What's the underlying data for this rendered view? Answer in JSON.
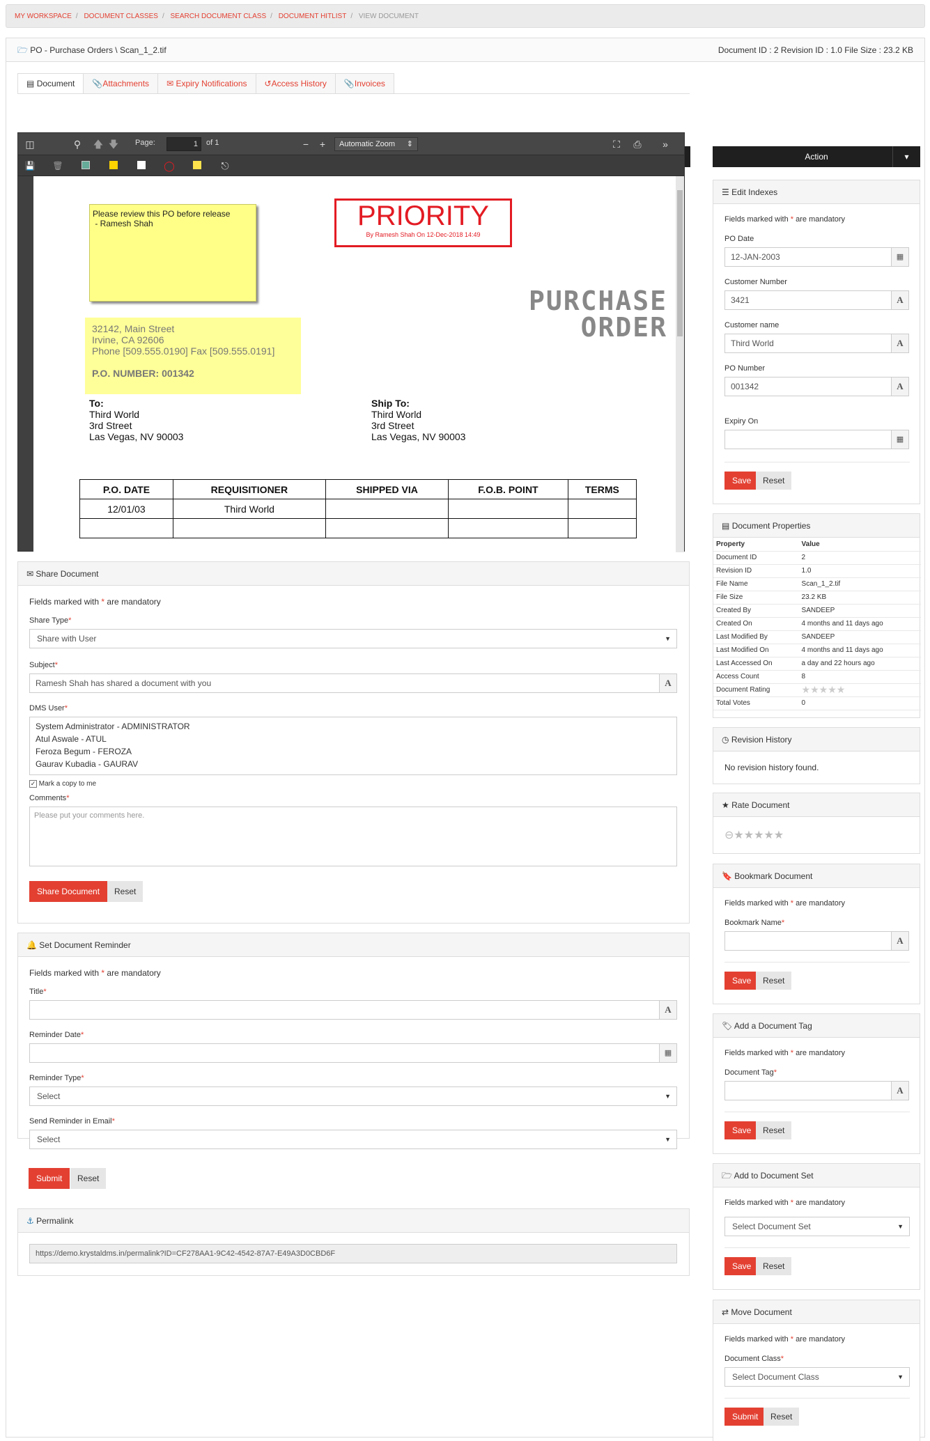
{
  "breadcrumb": [
    "MY WORKSPACE",
    "DOCUMENT CLASSES",
    "SEARCH DOCUMENT CLASS",
    "DOCUMENT HITLIST",
    "VIEW DOCUMENT"
  ],
  "doc_header": {
    "path": "PO - Purchase Orders \\ Scan_1_2.tif",
    "meta": "Document ID : 2  Revision ID : 1.0  File Size : 23.2 KB"
  },
  "tabs": [
    "Document",
    "Attachments",
    "Expiry Notifications",
    "Access History",
    "Invoices"
  ],
  "viewer": {
    "page_label": "Page:",
    "page_value": "1",
    "page_of": "of 1",
    "zoom": "Automatic Zoom"
  },
  "scan": {
    "sticky_note": "Please review this PO before release\n - Ramesh Shah",
    "stamp_title": "PRIORITY",
    "stamp_sub": "By Ramesh Shah On 12-Dec-2018 14:49",
    "address_line1": "32142, Main Street",
    "address_line2": "Irvine, CA 92606",
    "address_phone": "Phone [509.555.0190]  Fax [509.555.0191]",
    "po_number": "P.O. NUMBER: 001342",
    "title_line1": "PURCHASE",
    "title_line2": "ORDER",
    "to_label": "To:",
    "to_lines": [
      "Third World",
      "3rd Street",
      "Las Vegas, NV 90003"
    ],
    "ship_label": "Ship To:",
    "ship_lines": [
      "Third World",
      "3rd Street",
      "Las Vegas, NV 90003"
    ],
    "table_headers": [
      "P.O. DATE",
      "REQUISITIONER",
      "SHIPPED VIA",
      "F.O.B. POINT",
      "TERMS"
    ],
    "table_row": [
      "12/01/03",
      "Third World",
      "",
      "",
      ""
    ]
  },
  "share": {
    "title": "Share Document",
    "mandatory": "Fields marked with",
    "mandatory_tail": "are mandatory",
    "share_type_label": "Share Type",
    "share_type_value": "Share with User",
    "subject_label": "Subject",
    "subject_value": "Ramesh Shah has shared a document with you",
    "dms_user_label": "DMS User",
    "users": [
      "System Administrator - ADMINISTRATOR",
      "Atul Aswale - ATUL",
      "Feroza Begum - FEROZA",
      "Gaurav Kubadia - GAURAV"
    ],
    "copy_label": "Mark a copy to me",
    "comments_label": "Comments",
    "comments_placeholder": "Please put your comments here.",
    "submit": "Share Document",
    "reset": "Reset"
  },
  "reminder": {
    "title": "Set Document Reminder",
    "mandatory": "Fields marked with",
    "mandatory_tail": "are mandatory",
    "title_label": "Title",
    "date_label": "Reminder Date",
    "type_label": "Reminder Type",
    "type_value": "Select",
    "email_label": "Send Reminder in Email",
    "email_value": "Select",
    "submit": "Submit",
    "reset": "Reset"
  },
  "permalink": {
    "title": "Permalink",
    "url": "https://demo.krystaldms.in/permalink?ID=CF278AA1-9C42-4542-87A7-E49A3D0CBD6F"
  },
  "action": {
    "label": "Action"
  },
  "edit_indexes": {
    "title": "Edit Indexes",
    "mandatory": "Fields marked with",
    "mandatory_tail": "are mandatory",
    "fields": [
      {
        "label": "PO Date",
        "value": "12-JAN-2003"
      },
      {
        "label": "Customer Number",
        "value": "3421"
      },
      {
        "label": "Customer name",
        "value": "Third World"
      },
      {
        "label": "PO Number",
        "value": "001342"
      },
      {
        "label": "Expiry On",
        "value": ""
      }
    ],
    "save": "Save",
    "reset": "Reset"
  },
  "properties": {
    "title": "Document Properties",
    "head_property": "Property",
    "head_value": "Value",
    "rows": [
      [
        "Document ID",
        "2"
      ],
      [
        "Revision ID",
        "1.0"
      ],
      [
        "File Name",
        "Scan_1_2.tif"
      ],
      [
        "File Size",
        "23.2 KB"
      ],
      [
        "Created By",
        "SANDEEP"
      ],
      [
        "Created On",
        "4 months and 11 days ago"
      ],
      [
        "Last Modified By",
        "SANDEEP"
      ],
      [
        "Last Modified On",
        "4 months and 11 days ago"
      ],
      [
        "Last Accessed On",
        "a day and 22 hours ago"
      ],
      [
        "Access Count",
        "8"
      ],
      [
        "Document Rating",
        ""
      ],
      [
        "Total Votes",
        "0"
      ]
    ]
  },
  "revision": {
    "title": "Revision History",
    "text": "No revision history found."
  },
  "rate": {
    "title": "Rate Document"
  },
  "bookmark": {
    "title": "Bookmark Document",
    "mandatory": "Fields marked with",
    "mandatory_tail": "are mandatory",
    "label": "Bookmark Name",
    "save": "Save",
    "reset": "Reset"
  },
  "tag": {
    "title": "Add a Document Tag",
    "mandatory": "Fields marked with",
    "mandatory_tail": "are mandatory",
    "label": "Document Tag",
    "save": "Save",
    "reset": "Reset"
  },
  "docset": {
    "title": "Add to Document Set",
    "mandatory": "Fields marked with",
    "mandatory_tail": "are mandatory",
    "select": "Select Document Set",
    "save": "Save",
    "reset": "Reset"
  },
  "move": {
    "title": "Move Document",
    "mandatory": "Fields marked with",
    "mandatory_tail": "are mandatory",
    "label": "Document Class",
    "select": "Select Document Class",
    "submit": "Submit",
    "reset": "Reset"
  },
  "colors": {
    "accent": "#e34032",
    "dark": "#1f1f1f"
  }
}
